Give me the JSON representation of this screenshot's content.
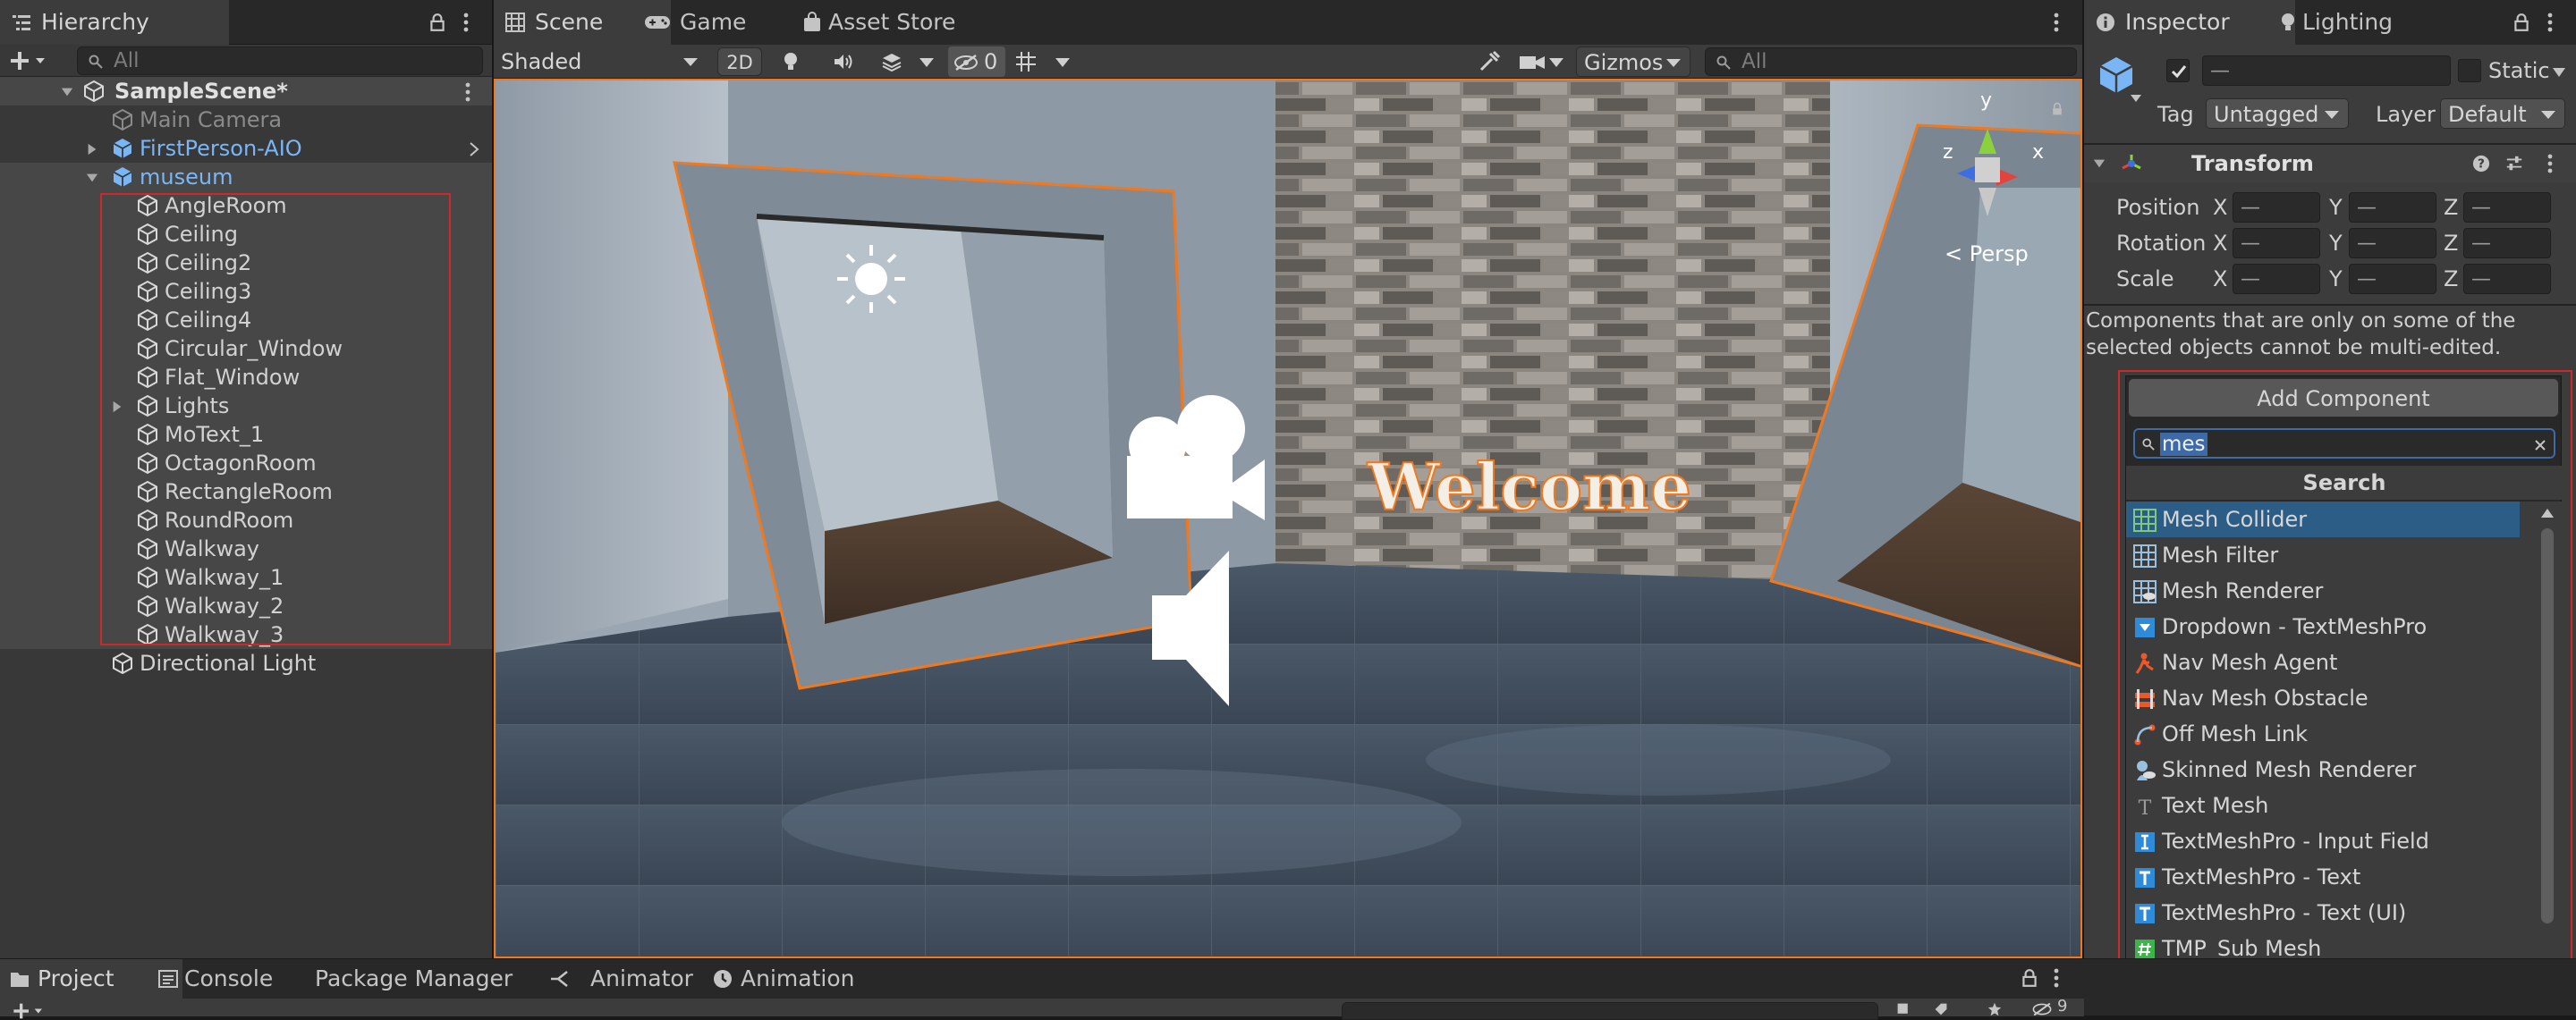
{
  "hierarchy": {
    "tab_label": "Hierarchy",
    "search_placeholder": "All",
    "scene_name": "SampleScene*",
    "items": [
      {
        "label": "Main Camera"
      },
      {
        "label": "FirstPerson-AIO"
      },
      {
        "label": "museum"
      },
      {
        "label": "AngleRoom"
      },
      {
        "label": "Ceiling"
      },
      {
        "label": "Ceiling2"
      },
      {
        "label": "Ceiling3"
      },
      {
        "label": "Ceiling4"
      },
      {
        "label": "Circular_Window"
      },
      {
        "label": "Flat_Window"
      },
      {
        "label": "Lights"
      },
      {
        "label": "MoText_1"
      },
      {
        "label": "OctagonRoom"
      },
      {
        "label": "RectangleRoom"
      },
      {
        "label": "RoundRoom"
      },
      {
        "label": "Walkway"
      },
      {
        "label": "Walkway_1"
      },
      {
        "label": "Walkway_2"
      },
      {
        "label": "Walkway_3"
      },
      {
        "label": "Directional Light"
      }
    ]
  },
  "scene": {
    "tabs": [
      {
        "label": "Scene"
      },
      {
        "label": "Game"
      },
      {
        "label": "Asset Store"
      }
    ],
    "shading_mode": "Shaded",
    "toggle_2d": "2D",
    "hidden_count": "0",
    "gizmos_label": "Gizmos",
    "search_placeholder": "All",
    "persp_label": "Persp",
    "axis_x": "x",
    "axis_y": "y",
    "axis_z": "z",
    "welcome_text": "Welcome"
  },
  "inspector": {
    "tabs": [
      {
        "label": "Inspector"
      },
      {
        "label": "Lighting"
      }
    ],
    "name_value": "—",
    "static_label": "Static",
    "tag_label": "Tag",
    "tag_value": "Untagged",
    "layer_label": "Layer",
    "layer_value": "Default",
    "transform_title": "Transform",
    "rows": [
      {
        "label": "Position"
      },
      {
        "label": "Rotation"
      },
      {
        "label": "Scale"
      }
    ],
    "axis_x": "X",
    "axis_y": "Y",
    "axis_z": "Z",
    "mixed_value": "—",
    "note": "Components that are only on some of the selected objects cannot be multi-edited.",
    "add_component_label": "Add Component",
    "component_search_value": "mes",
    "search_header": "Search",
    "results": [
      {
        "label": "Mesh Collider",
        "icon": "mesh-collider-icon"
      },
      {
        "label": "Mesh Filter",
        "icon": "mesh-filter-icon"
      },
      {
        "label": "Mesh Renderer",
        "icon": "mesh-renderer-icon"
      },
      {
        "label": "Dropdown - TextMeshPro",
        "icon": "dropdown-icon"
      },
      {
        "label": "Nav Mesh Agent",
        "icon": "nav-mesh-agent-icon"
      },
      {
        "label": "Nav Mesh Obstacle",
        "icon": "nav-mesh-obstacle-icon"
      },
      {
        "label": "Off Mesh Link",
        "icon": "off-mesh-link-icon"
      },
      {
        "label": "Skinned Mesh Renderer",
        "icon": "skinned-mesh-renderer-icon"
      },
      {
        "label": "Text Mesh",
        "icon": "text-mesh-icon"
      },
      {
        "label": "TextMeshPro - Input Field",
        "icon": "input-field-icon"
      },
      {
        "label": "TextMeshPro - Text",
        "icon": "textmeshpro-icon"
      },
      {
        "label": "TextMeshPro - Text (UI)",
        "icon": "textmeshpro-ui-icon"
      },
      {
        "label": "TMP_Sub Mesh",
        "icon": "tmp-sub-mesh-icon"
      }
    ]
  },
  "bottom": {
    "tabs": [
      {
        "label": "Project"
      },
      {
        "label": "Console"
      },
      {
        "label": "Package Manager"
      },
      {
        "label": "Animator"
      },
      {
        "label": "Animation"
      }
    ],
    "layer_count": "9"
  },
  "colors": {
    "selection_blue": "#2c5d87",
    "highlight_blue": "#3e6aa8",
    "prefab_blue": "#7ab6f5",
    "orange_outline": "#f0781e",
    "red_annotation": "#cc2a2a"
  }
}
